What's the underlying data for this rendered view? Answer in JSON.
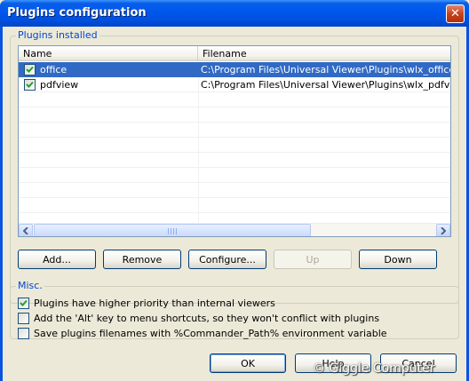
{
  "window": {
    "title": "Plugins configuration"
  },
  "plugins_group": {
    "label": "Plugins installed",
    "columns": {
      "name": "Name",
      "filename": "Filename"
    },
    "rows": [
      {
        "name": "office",
        "filename": "C:\\Program Files\\Universal Viewer\\Plugins\\wlx_office\\office.wlx",
        "checked": true,
        "selected": true
      },
      {
        "name": "pdfview",
        "filename": "C:\\Program Files\\Universal Viewer\\Plugins\\wlx_pdfview\\pdfview.wlx",
        "checked": true,
        "selected": false
      }
    ]
  },
  "plugin_buttons": {
    "add": "Add...",
    "remove": "Remove",
    "configure": "Configure...",
    "up": "Up",
    "down": "Down"
  },
  "misc_group": {
    "label": "Misc.",
    "options": [
      {
        "label": "Plugins have higher priority than internal viewers",
        "checked": true
      },
      {
        "label": "Add the 'Alt' key to menu shortcuts, so they won't conflict with plugins",
        "checked": false
      },
      {
        "label": "Save plugins filenames with %Commander_Path% environment variable",
        "checked": false
      }
    ]
  },
  "dialog_buttons": {
    "ok": "OK",
    "help": "Help",
    "cancel": "Cancel"
  },
  "watermark": "© Giggle Computer",
  "colors": {
    "title_bar": "#0058ee",
    "selection": "#316ac5",
    "group_label": "#0046d5"
  }
}
